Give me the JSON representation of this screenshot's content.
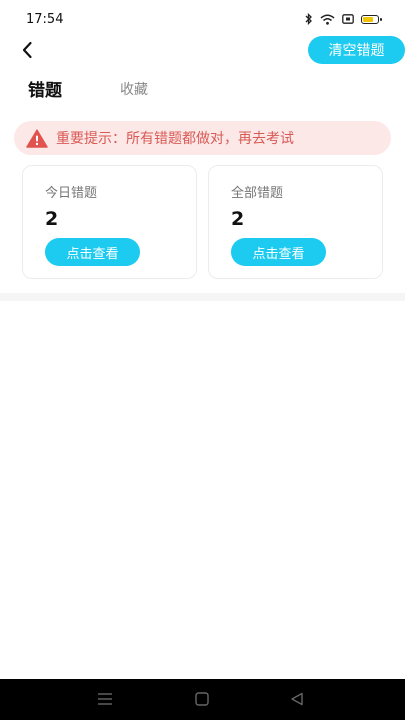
{
  "status_bar": {
    "time": "17:54",
    "icons": [
      "bluetooth-icon",
      "wifi-icon",
      "sim-icon",
      "battery-icon"
    ]
  },
  "header": {
    "back_icon": "chevron-left-icon",
    "clear_label": "清空错题"
  },
  "tabs": [
    {
      "label": "错题",
      "active": true
    },
    {
      "label": "收藏",
      "active": false
    }
  ],
  "notice": {
    "icon": "warning-icon",
    "text": "重要提示：所有错题都做对，再去考试"
  },
  "cards": [
    {
      "title": "今日错题",
      "count": "2",
      "button_label": "点击查看"
    },
    {
      "title": "全部错题",
      "count": "2",
      "button_label": "点击查看"
    }
  ],
  "colors": {
    "accent": "#1ecbf0",
    "warning_bg": "#fde8e8",
    "warning_text": "#d85a55"
  },
  "nav_bar": {
    "icons": [
      "menu-icon",
      "home-icon",
      "back-icon"
    ]
  }
}
